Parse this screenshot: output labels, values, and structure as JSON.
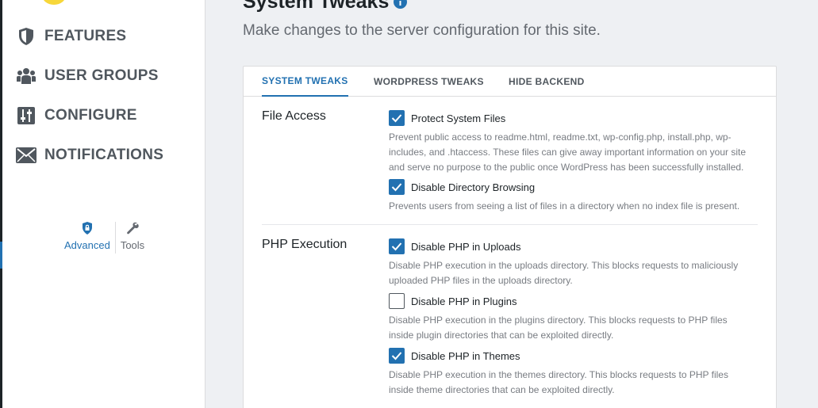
{
  "sidebar": {
    "nav": [
      {
        "label": "FEATURES",
        "icon": "shield-icon"
      },
      {
        "label": "USER GROUPS",
        "icon": "user-group-icon"
      },
      {
        "label": "CONFIGURE",
        "icon": "sliders-icon"
      },
      {
        "label": "NOTIFICATIONS",
        "icon": "envelope-icon"
      }
    ],
    "subnav": [
      {
        "label": "Advanced",
        "icon": "lock-shield-icon",
        "active": true
      },
      {
        "label": "Tools",
        "icon": "wrench-icon",
        "active": false
      }
    ]
  },
  "header": {
    "title": "System Tweaks",
    "subtitle": "Make changes to the server configuration for this site."
  },
  "tabs": [
    {
      "label": "SYSTEM TWEAKS",
      "active": true
    },
    {
      "label": "WORDPRESS TWEAKS",
      "active": false
    },
    {
      "label": "HIDE BACKEND",
      "active": false
    }
  ],
  "sections": [
    {
      "label": "File Access",
      "options": [
        {
          "label": "Protect System Files",
          "checked": true,
          "description": "Prevent public access to readme.html, readme.txt, wp-config.php, install.php, wp-includes, and .htaccess. These files can give away important information on your site and serve no purpose to the public once WordPress has been successfully installed."
        },
        {
          "label": "Disable Directory Browsing",
          "checked": true,
          "description": "Prevents users from seeing a list of files in a directory when no index file is present."
        }
      ]
    },
    {
      "label": "PHP Execution",
      "options": [
        {
          "label": "Disable PHP in Uploads",
          "checked": true,
          "description": "Disable PHP execution in the uploads directory. This blocks requests to maliciously uploaded PHP files in the uploads directory."
        },
        {
          "label": "Disable PHP in Plugins",
          "checked": false,
          "description": "Disable PHP execution in the plugins directory. This blocks requests to PHP files inside plugin directories that can be exploited directly."
        },
        {
          "label": "Disable PHP in Themes",
          "checked": true,
          "description": "Disable PHP execution in the themes directory. This blocks requests to PHP files inside theme directories that can be exploited directly."
        }
      ]
    }
  ],
  "colors": {
    "accent": "#2271b1",
    "background": "#eef0f3",
    "logo": "#f7d73a"
  }
}
